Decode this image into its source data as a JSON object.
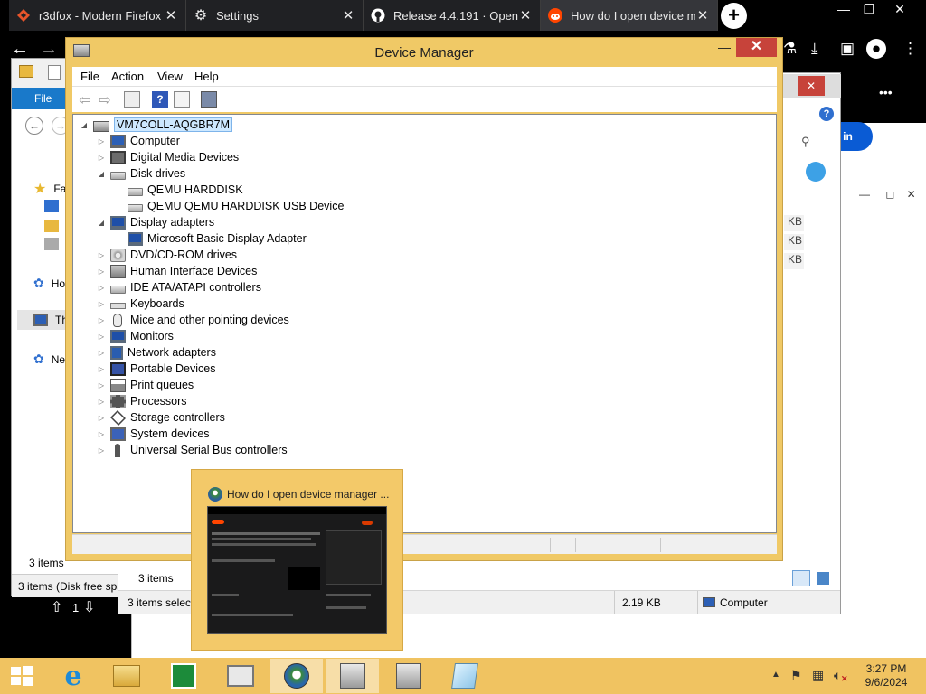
{
  "browser": {
    "tabs": [
      {
        "title": "r3dfox - Modern Firefox",
        "icon": "r3dfox-icon",
        "active": false
      },
      {
        "title": "Settings",
        "icon": "gear-icon",
        "active": false
      },
      {
        "title": "Release 4.4.191 · Open-",
        "icon": "github-icon",
        "active": false
      },
      {
        "title": "How do I open device m",
        "icon": "reddit-icon",
        "active": true
      }
    ],
    "new_tab": "+",
    "close_glyph": "✕"
  },
  "explorer": {
    "file_tab": "File",
    "nav_labels": [
      "Fa",
      "",
      "",
      "",
      "Ho",
      "Th",
      "Ne"
    ],
    "items_count": "3 items",
    "status_left": "3 items (Disk free spa",
    "up_count": "1"
  },
  "explorer2": {
    "items_count": "3 items",
    "status_selected": "3 items select",
    "status_size": "2.19 KB",
    "status_location": "Computer",
    "kb_labels": [
      "KB",
      "KB",
      "KB"
    ]
  },
  "reddit": {
    "button_partial": "in",
    "login_partial": "in",
    "more": "•••"
  },
  "device_manager": {
    "title": "Device Manager",
    "menu": [
      "File",
      "Action",
      "View",
      "Help"
    ],
    "root": "VM7COLL-AQGBR7M",
    "tree": [
      {
        "label": "Computer",
        "icon": "computer",
        "level": 1,
        "expander": "▷"
      },
      {
        "label": "Digital Media Devices",
        "icon": "media",
        "level": 1,
        "expander": "▷"
      },
      {
        "label": "Disk drives",
        "icon": "disk",
        "level": 1,
        "expander": "◢"
      },
      {
        "label": "QEMU HARDDISK",
        "icon": "disk",
        "level": 2,
        "expander": ""
      },
      {
        "label": "QEMU QEMU HARDDISK USB Device",
        "icon": "disk",
        "level": 2,
        "expander": ""
      },
      {
        "label": "Display adapters",
        "icon": "monitor",
        "level": 1,
        "expander": "◢"
      },
      {
        "label": "Microsoft Basic Display Adapter",
        "icon": "monitor",
        "level": 2,
        "expander": ""
      },
      {
        "label": "DVD/CD-ROM drives",
        "icon": "cd",
        "level": 1,
        "expander": "▷"
      },
      {
        "label": "Human Interface Devices",
        "icon": "gray",
        "level": 1,
        "expander": "▷"
      },
      {
        "label": "IDE ATA/ATAPI controllers",
        "icon": "disk",
        "level": 1,
        "expander": "▷"
      },
      {
        "label": "Keyboards",
        "icon": "kbd",
        "level": 1,
        "expander": "▷"
      },
      {
        "label": "Mice and other pointing devices",
        "icon": "mouse",
        "level": 1,
        "expander": "▷"
      },
      {
        "label": "Monitors",
        "icon": "monitor",
        "level": 1,
        "expander": "▷"
      },
      {
        "label": "Network adapters",
        "icon": "net",
        "level": 1,
        "expander": "▷"
      },
      {
        "label": "Portable Devices",
        "icon": "port",
        "level": 1,
        "expander": "▷"
      },
      {
        "label": "Print queues",
        "icon": "printer",
        "level": 1,
        "expander": "▷"
      },
      {
        "label": "Processors",
        "icon": "cpu",
        "level": 1,
        "expander": "▷"
      },
      {
        "label": "Storage controllers",
        "icon": "storage",
        "level": 1,
        "expander": "▷"
      },
      {
        "label": "System devices",
        "icon": "sys",
        "level": 1,
        "expander": "▷"
      },
      {
        "label": "Universal Serial Bus controllers",
        "icon": "usb",
        "level": 1,
        "expander": "▷"
      }
    ]
  },
  "preview": {
    "title": "How do I open device manager ..."
  },
  "taskbar": {
    "time": "3:27 PM",
    "date": "9/6/2024",
    "items": [
      "start-button",
      "internet-explorer",
      "file-explorer",
      "store",
      "task-manager",
      "browser",
      "device-manager",
      "device-manager-2",
      "notepad"
    ]
  }
}
